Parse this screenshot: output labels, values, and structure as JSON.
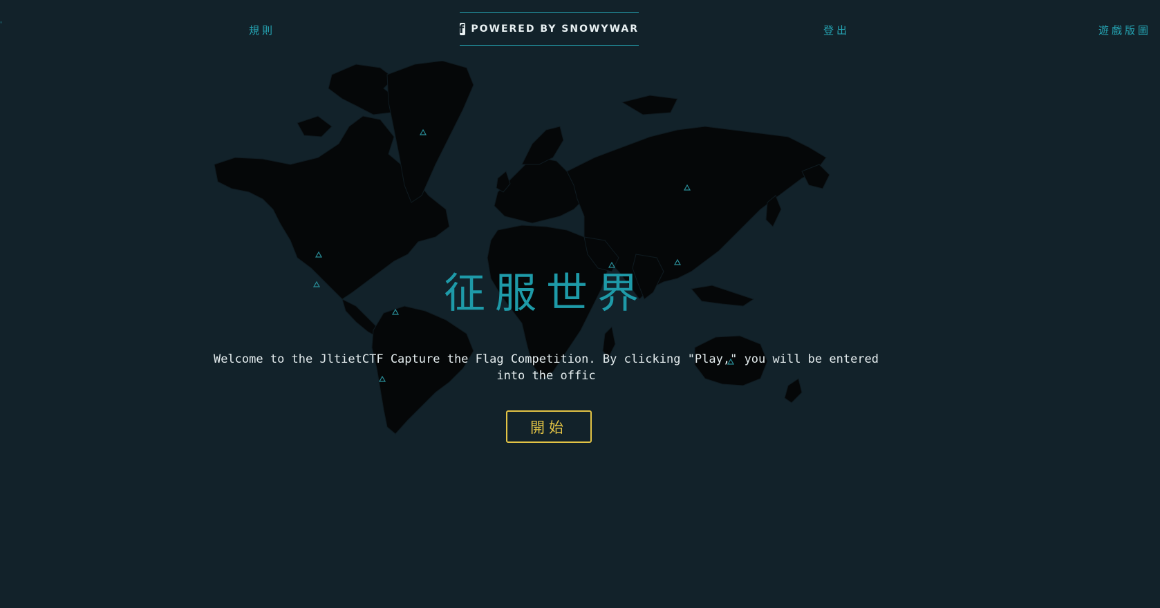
{
  "nav": {
    "edge_fragment": "'",
    "rules_label": "規則",
    "logout_label": "登出",
    "leaderboard_label": "遊戲版圖"
  },
  "brand": {
    "icon": "facebook-icon",
    "text": "POWERED BY SNOWYWAR"
  },
  "hero": {
    "title": "征服世界",
    "welcome_text": "Welcome to the JltietCTF Capture the Flag Competition. By clicking \"Play,\" you will be entered into the offic",
    "play_label": "開始"
  },
  "colors": {
    "background": "#12222a",
    "accent": "#25a4b3",
    "title": "#1e9aa8",
    "button": "#e3c445",
    "land": "#050708"
  }
}
